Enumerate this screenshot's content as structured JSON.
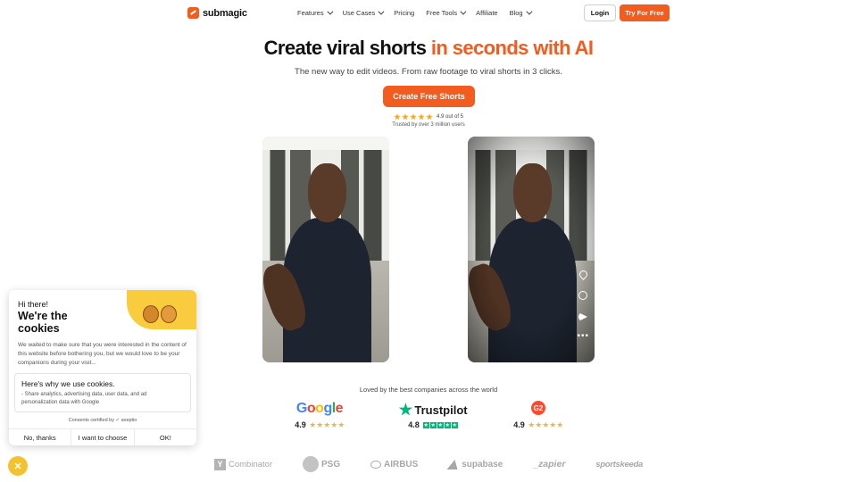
{
  "nav": {
    "logo_text": "submagic",
    "menu": [
      {
        "label": "Features",
        "has_dropdown": true
      },
      {
        "label": "Use Cases",
        "has_dropdown": true
      },
      {
        "label": "Pricing",
        "has_dropdown": false
      },
      {
        "label": "Free Tools",
        "has_dropdown": true
      },
      {
        "label": "Affiliate",
        "has_dropdown": false
      },
      {
        "label": "Blog",
        "has_dropdown": true
      }
    ],
    "login_label": "Login",
    "try_label": "Try For Free"
  },
  "hero": {
    "title_main": "Create viral shorts ",
    "title_accent": "in seconds with AI",
    "subtitle": "The new way to edit videos. From raw footage to viral shorts in 3 clicks.",
    "cta_label": "Create Free Shorts",
    "rating_text": "4.9 out of 5",
    "rating_value": 4.9,
    "trusted_text": "Trusted by over 3 million users"
  },
  "videos": [
    {
      "name": "before"
    },
    {
      "name": "after",
      "icons": [
        "heart-icon",
        "comment-icon",
        "share-icon",
        "more-icon"
      ]
    }
  ],
  "reviews": {
    "heading": "Loved by the best companies across the world",
    "google": {
      "brand": "Google",
      "score": "4.9"
    },
    "trustpilot": {
      "brand": "Trustpilot",
      "score": "4.8"
    },
    "g2": {
      "brand": "G2",
      "score": "4.9"
    }
  },
  "companies": {
    "ycombinator": {
      "mark": "Y",
      "label": "Combinator"
    },
    "psg": "PSG",
    "airbus": "AIRBUS",
    "supabase": "supabase",
    "zapier": "_zapier",
    "sportskeeda": "sportskeeda"
  },
  "cookie": {
    "greeting": "Hi there!",
    "title": "We're the cookies",
    "body": "We waited to make sure that you were interested in the content of this website before bothering you, but we would love to be your companions during your visit...",
    "why_title": "Here's why we use cookies.",
    "why_text": "- Share analytics, advertising data, user data, and ad personalization data with Google",
    "certified": "Consents certified by ✓ axeptio",
    "btn_no": "No, thanks",
    "btn_choose": "I want to choose",
    "btn_ok": "OK!",
    "close_glyph": "✕"
  },
  "colors": {
    "brand_orange": "#f25c1f",
    "trustpilot_green": "#00b67a",
    "cookie_yellow": "#f9cc3e"
  }
}
